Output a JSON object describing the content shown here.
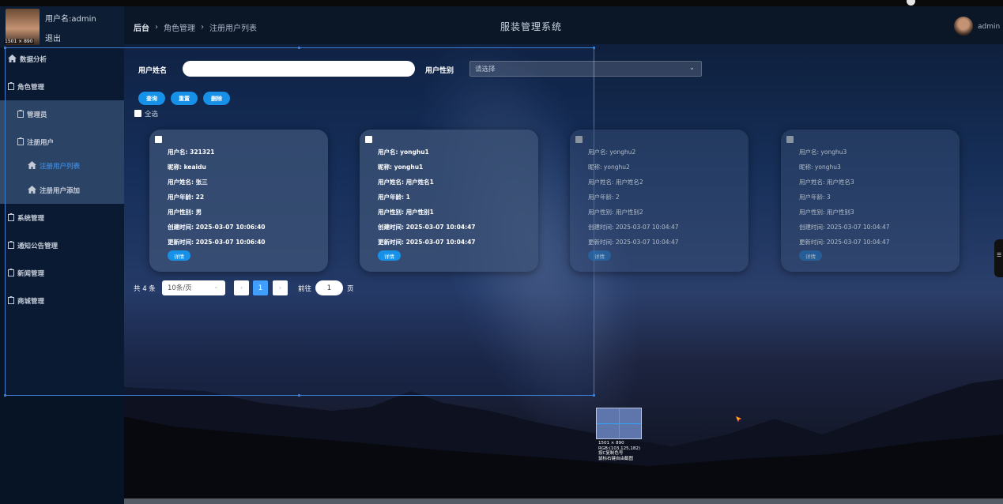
{
  "sidebar": {
    "username": "用户名:admin",
    "logout": "退出",
    "size_badge": "1501 × 890",
    "items": [
      {
        "label": "数据分析",
        "icon": "home-icon"
      },
      {
        "label": "角色管理",
        "icon": "clipboard-icon"
      },
      {
        "label": "管理员",
        "icon": "clipboard-icon"
      },
      {
        "label": "注册用户",
        "icon": "clipboard-icon"
      },
      {
        "label": "注册用户列表",
        "icon": "home-icon"
      },
      {
        "label": "注册用户添加",
        "icon": "home-icon"
      },
      {
        "label": "系统管理",
        "icon": "clipboard-icon"
      },
      {
        "label": "通知公告管理",
        "icon": "clipboard-icon"
      },
      {
        "label": "新闻管理",
        "icon": "clipboard-icon"
      },
      {
        "label": "商城管理",
        "icon": "clipboard-icon"
      }
    ]
  },
  "header": {
    "breadcrumb": [
      "后台",
      "角色管理",
      "注册用户列表"
    ],
    "title": "服装管理系统",
    "user": "admin"
  },
  "search": {
    "name_label": "用户姓名",
    "name_value": "",
    "gender_label": "用户性别",
    "gender_placeholder": "请选择",
    "query": "查询",
    "reset": "重置",
    "delete": "删除",
    "select_all": "全选"
  },
  "cards": [
    {
      "username": "用户名: 321321",
      "nickname": "昵称: keaidu",
      "realname": "用户姓名: 张三",
      "age": "用户年龄: 22",
      "gender": "用户性别: 男",
      "created": "创建时间: 2025-03-07 10:06:40",
      "updated": "更新时间: 2025-03-07 10:06:40",
      "detail": "详情"
    },
    {
      "username": "用户名: yonghu1",
      "nickname": "昵称: yonghu1",
      "realname": "用户姓名: 用户姓名1",
      "age": "用户年龄: 1",
      "gender": "用户性别: 用户性别1",
      "created": "创建时间: 2025-03-07 10:04:47",
      "updated": "更新时间: 2025-03-07 10:04:47",
      "detail": "详情"
    },
    {
      "username": "用户名: yonghu2",
      "nickname": "昵称: yonghu2",
      "realname": "用户姓名: 用户姓名2",
      "age": "用户年龄: 2",
      "gender": "用户性别: 用户性别2",
      "created": "创建时间: 2025-03-07 10:04:47",
      "updated": "更新时间: 2025-03-07 10:04:47",
      "detail": "详情"
    },
    {
      "username": "用户名: yonghu3",
      "nickname": "昵称: yonghu3",
      "realname": "用户姓名: 用户姓名3",
      "age": "用户年龄: 3",
      "gender": "用户性别: 用户性别3",
      "created": "创建时间: 2025-03-07 10:04:47",
      "updated": "更新时间: 2025-03-07 10:04:47",
      "detail": "详情"
    }
  ],
  "pagination": {
    "total": "共 4 条",
    "page_size": "10条/页",
    "current": "1",
    "goto": "前往",
    "goto_value": "1",
    "page_unit": "页"
  },
  "magnifier": {
    "size": "1501 × 890",
    "rgb": "RGB:(103,125,182)",
    "hint1": "按C复制色号",
    "hint2": "鼠标右键自由截图"
  },
  "side_tab": "☰"
}
